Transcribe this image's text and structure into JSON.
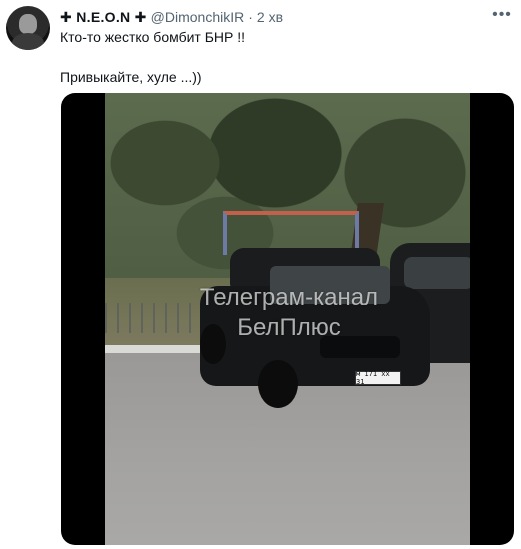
{
  "tweet": {
    "display_name": "✚ N.E.O.N ✚",
    "handle": "@DimonchikIR",
    "dot": "·",
    "time": "2 хв",
    "more_icon": "more-horizontal-icon",
    "text_lines": [
      "Кто-то жестко бомбит БНР !!",
      "Привыкайте, хуле ...))"
    ]
  },
  "media": {
    "watermark_line1": "Телеграм-канал",
    "watermark_line2": "БелПлюс",
    "plate": "м 171 хх 31"
  }
}
